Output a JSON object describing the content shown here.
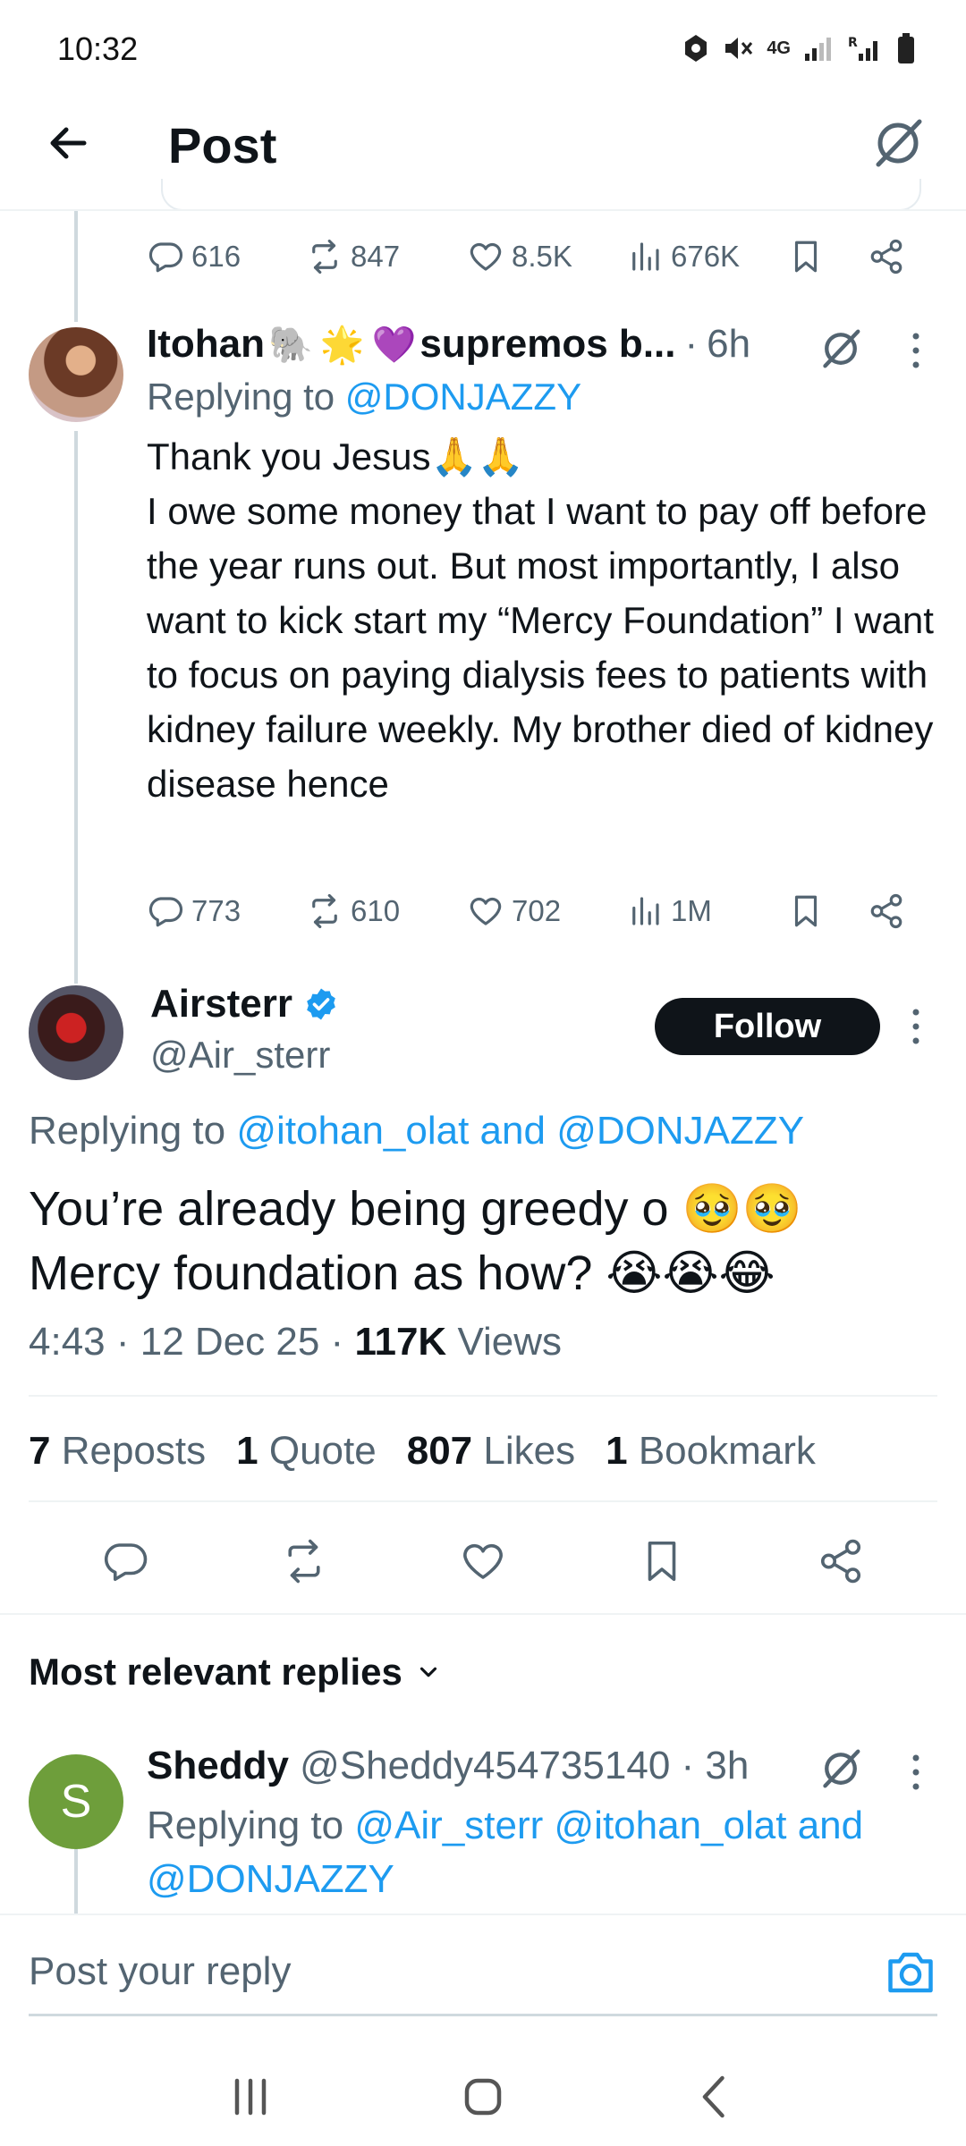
{
  "status_bar": {
    "time": "10:32",
    "network": "4G",
    "icons": [
      "vpn-icon",
      "mute-icon",
      "signal-icon",
      "signal-roaming-icon",
      "battery-icon"
    ]
  },
  "header": {
    "title": "Post",
    "back_icon": "arrow-left-icon",
    "grok_icon": "grok-icon"
  },
  "quoted_post_actions": {
    "replies": "616",
    "reposts": "847",
    "likes": "8.5K",
    "views": "676K"
  },
  "reply_itohan": {
    "name": "Itohan",
    "name_suffix": "supremos b...",
    "emojis": [
      "🐘",
      "🌟",
      "💜"
    ],
    "separator": "·",
    "time": "6h",
    "replying_prefix": "Replying to",
    "replying_to": "@DONJAZZY",
    "body": "Thank you Jesus🙏🙏\nI owe some money that I want to pay off before the year runs out. But most importantly, I also want to kick start my “Mercy Foundation” I want to focus on paying dialysis fees to patients with kidney failure weekly. My brother died of kidney disease hence",
    "replies": "773",
    "reposts": "610",
    "likes": "702",
    "views": "1M"
  },
  "main_post": {
    "name": "Airsterr",
    "handle": "@Air_sterr",
    "follow_label": "Follow",
    "replying_prefix": "Replying to",
    "replying_to": "@itohan_olat and @DONJAZZY",
    "body_line1": "You’re already being greedy o 🥹🥹",
    "body_line2": "Mercy foundation as how? 😭😭😂",
    "time": "4:43",
    "date": "12 Dec 25",
    "views_count": "117K",
    "views_label": "Views",
    "stats": {
      "reposts_count": "7",
      "reposts_label": "Reposts",
      "quotes_count": "1",
      "quotes_label": "Quote",
      "likes_count": "807",
      "likes_label": "Likes",
      "bookmarks_count": "1",
      "bookmarks_label": "Bookmark"
    }
  },
  "replies_section": {
    "sort_label": "Most relevant replies"
  },
  "reply_sheddy": {
    "avatar_letter": "S",
    "name": "Sheddy",
    "handle": "@Sheddy454735140",
    "separator": "·",
    "time": "3h",
    "replying_prefix": "Replying to",
    "replying_to": "@Air_sterr @itohan_olat and @DONJAZZY"
  },
  "composer": {
    "placeholder": "Post your reply"
  },
  "colors": {
    "accent": "#1d9bf0",
    "text": "#0f1419",
    "muted": "#536471",
    "divider": "#eff3f4"
  }
}
